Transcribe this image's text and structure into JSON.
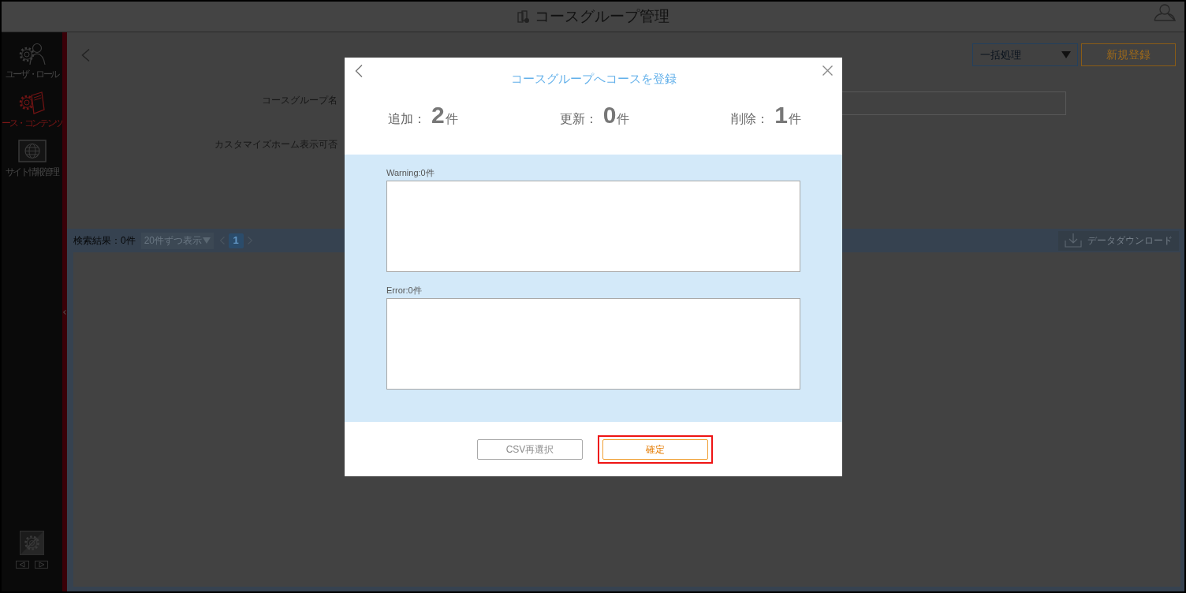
{
  "header": {
    "title": "コースグループ管理"
  },
  "sidebar": {
    "items": [
      {
        "label": "ユーザ・ロール",
        "kind": "users",
        "selected": false
      },
      {
        "label": "ース・コンテンツ",
        "kind": "contents",
        "selected": true
      },
      {
        "label": "サイト情報管理",
        "kind": "site",
        "selected": false
      }
    ]
  },
  "toolbar": {
    "bulk_select": "一括処理",
    "new_button": "新規登録"
  },
  "form": {
    "rows": [
      {
        "label": "コースグループ名",
        "kind": "text_field"
      },
      {
        "label": "カスタマイズホーム表示可否",
        "kind": "covered"
      }
    ]
  },
  "results_bar": {
    "count": "検索結果：0件",
    "page_size": "20件ずつ表示",
    "pages": [
      {
        "label": "1",
        "selected": true
      }
    ],
    "download_button": "データダウンロード"
  },
  "dialog": {
    "title": "コースグループへコースを登録",
    "stats": [
      {
        "label": "追加：",
        "value": "2",
        "unit": "件"
      },
      {
        "label": "更新：",
        "value": "0",
        "unit": "件"
      },
      {
        "label": "削除：",
        "value": "1",
        "unit": "件"
      }
    ],
    "logs": [
      {
        "label": "Warning:0件"
      },
      {
        "label": "Error:0件"
      }
    ],
    "buttons": [
      {
        "label": "CSV再選択",
        "kind": "secondary",
        "highlighted": false
      },
      {
        "label": "確定",
        "kind": "primary",
        "highlighted": true
      }
    ]
  }
}
